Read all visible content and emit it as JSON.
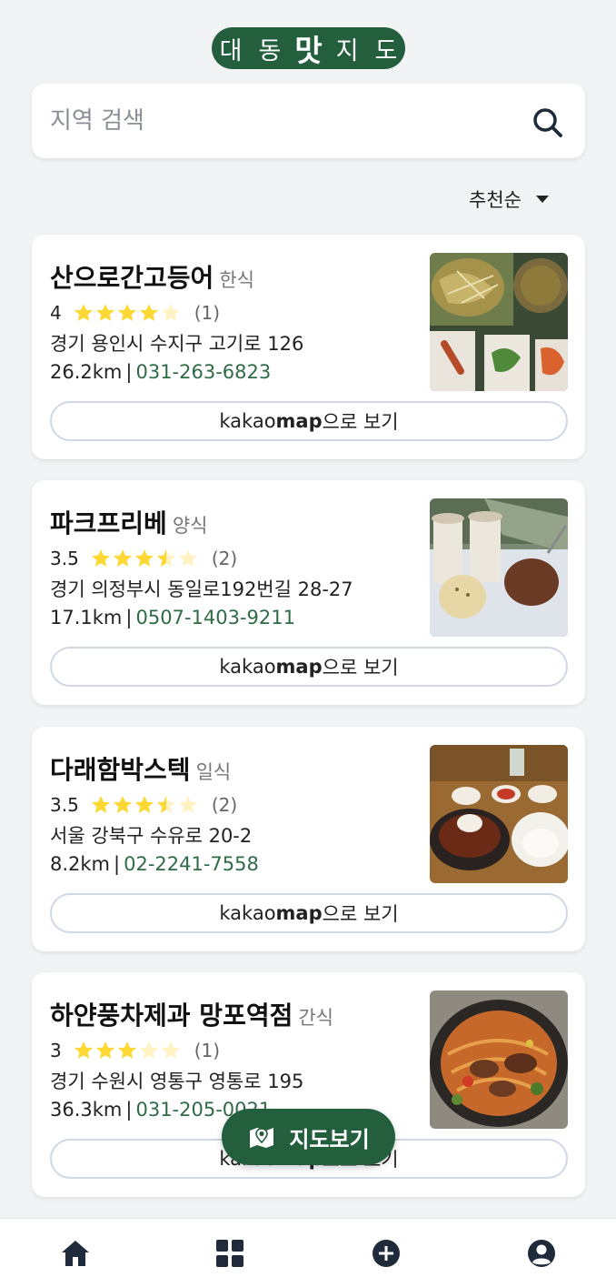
{
  "header": {
    "logo": [
      "대",
      "동",
      "맛",
      "지",
      "도"
    ]
  },
  "search": {
    "placeholder": "지역 검색",
    "value": ""
  },
  "sort": {
    "selected": "추천순"
  },
  "restaurants": [
    {
      "name": "산으로간고등어",
      "category": "한식",
      "rating": "4",
      "rating_value": 4,
      "review_count": "(1)",
      "address": "경기 용인시 수지구 고기로 126",
      "distance": "26.2km",
      "phone": "031-263-6823",
      "map_label_prefix": "kakao",
      "map_label_brand": "map",
      "map_label_suffix": "으로 보기"
    },
    {
      "name": "파크프리베",
      "category": "양식",
      "rating": "3.5",
      "rating_value": 3.5,
      "review_count": "(2)",
      "address": "경기 의정부시 동일로192번길 28-27",
      "distance": "17.1km",
      "phone": "0507-1403-9211",
      "map_label_prefix": "kakao",
      "map_label_brand": "map",
      "map_label_suffix": "으로 보기"
    },
    {
      "name": "다래함박스텍",
      "category": "일식",
      "rating": "3.5",
      "rating_value": 3.5,
      "review_count": "(2)",
      "address": "서울 강북구 수유로 20-2",
      "distance": "8.2km",
      "phone": "02-2241-7558",
      "map_label_prefix": "kakao",
      "map_label_brand": "map",
      "map_label_suffix": "으로 보기"
    },
    {
      "name": "하얀풍차제과 망포역점",
      "category": "간식",
      "rating": "3",
      "rating_value": 3,
      "review_count": "(1)",
      "address": "경기 수원시 영통구 영통로 195",
      "distance": "36.3km",
      "phone": "031-205-0021",
      "map_label_prefix": "kakao",
      "map_label_brand": "map",
      "map_label_suffix": "으로 보기"
    }
  ],
  "fab": {
    "label": "지도보기",
    "icon": "map-icon"
  },
  "bottom_nav": {
    "items": [
      {
        "icon": "home-icon"
      },
      {
        "icon": "grid-icon"
      },
      {
        "icon": "add-circle-icon"
      },
      {
        "icon": "profile-icon"
      }
    ]
  },
  "colors": {
    "brand": "#245f3d",
    "star": "#fdd835",
    "star_empty": "#fff3c4",
    "phone": "#2f6b47",
    "icon": "#1f2a3a"
  }
}
